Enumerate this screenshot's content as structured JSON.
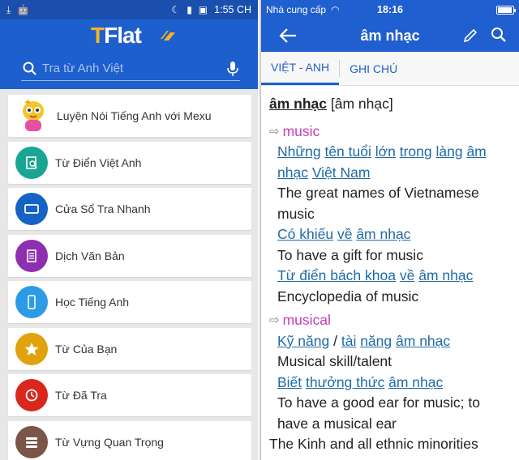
{
  "left": {
    "status_bar": {
      "time": "1:55 CH"
    },
    "logo": {
      "part1": "T",
      "part2": "Flat"
    },
    "search": {
      "placeholder": "Tra từ Anh Việt"
    },
    "menu": [
      {
        "label": "Luyện Nói Tiếng Anh với Mexu",
        "icon": "mascot-icon",
        "color": ""
      },
      {
        "label": "Từ Điển Việt Anh",
        "icon": "dictionary-icon",
        "color": "#1aa592"
      },
      {
        "label": "Cửa Sổ Tra Nhanh",
        "icon": "window-icon",
        "color": "#1563c4"
      },
      {
        "label": "Dịch Văn Bản",
        "icon": "document-icon",
        "color": "#8d2fb0"
      },
      {
        "label": "Học Tiếng Anh",
        "icon": "phone-icon",
        "color": "#2c9be6"
      },
      {
        "label": "Từ Của Bạn",
        "icon": "star-icon",
        "color": "#e0a20d"
      },
      {
        "label": "Từ Đã Tra",
        "icon": "history-icon",
        "color": "#d9271d"
      },
      {
        "label": "Từ Vựng Quan Trọng",
        "icon": "stack-icon",
        "color": "#7b5548"
      }
    ]
  },
  "right": {
    "status_bar": {
      "carrier": "Nhà cung cấp",
      "time": "18:16"
    },
    "nav": {
      "title": "âm nhạc"
    },
    "tabs": {
      "tab1": "VIỆT - ANH",
      "tab2": "GHI CHÚ"
    },
    "entry": {
      "headword": "âm nhạc",
      "pronunciation": "[âm nhạc]",
      "senses": [
        {
          "word": "music",
          "examples": [
            {
              "vi": [
                "Những",
                "tên tuổi",
                "lớn",
                "trong",
                "làng",
                "âm nhạc",
                "Việt Nam"
              ],
              "en": "The great names of Vietnamese music"
            },
            {
              "vi": [
                "Có khiếu",
                "về",
                "âm nhạc"
              ],
              "en": "To have a gift for music"
            },
            {
              "vi": [
                "Từ điển bách khoa",
                "về",
                "âm nhạc"
              ],
              "en": "Encyclopedia of music"
            }
          ]
        },
        {
          "word": "musical",
          "examples": [
            {
              "vi": [
                "Kỹ năng",
                "/",
                "tài",
                "năng",
                "âm nhạc"
              ],
              "en": "Musical skill/talent"
            },
            {
              "vi": [
                "Biết",
                "thưởng thức",
                "âm nhạc"
              ],
              "en": "To have a good ear for music; to have a musical ear"
            }
          ]
        }
      ],
      "trailing_text": "The Kinh and all ethnic minorities"
    }
  }
}
